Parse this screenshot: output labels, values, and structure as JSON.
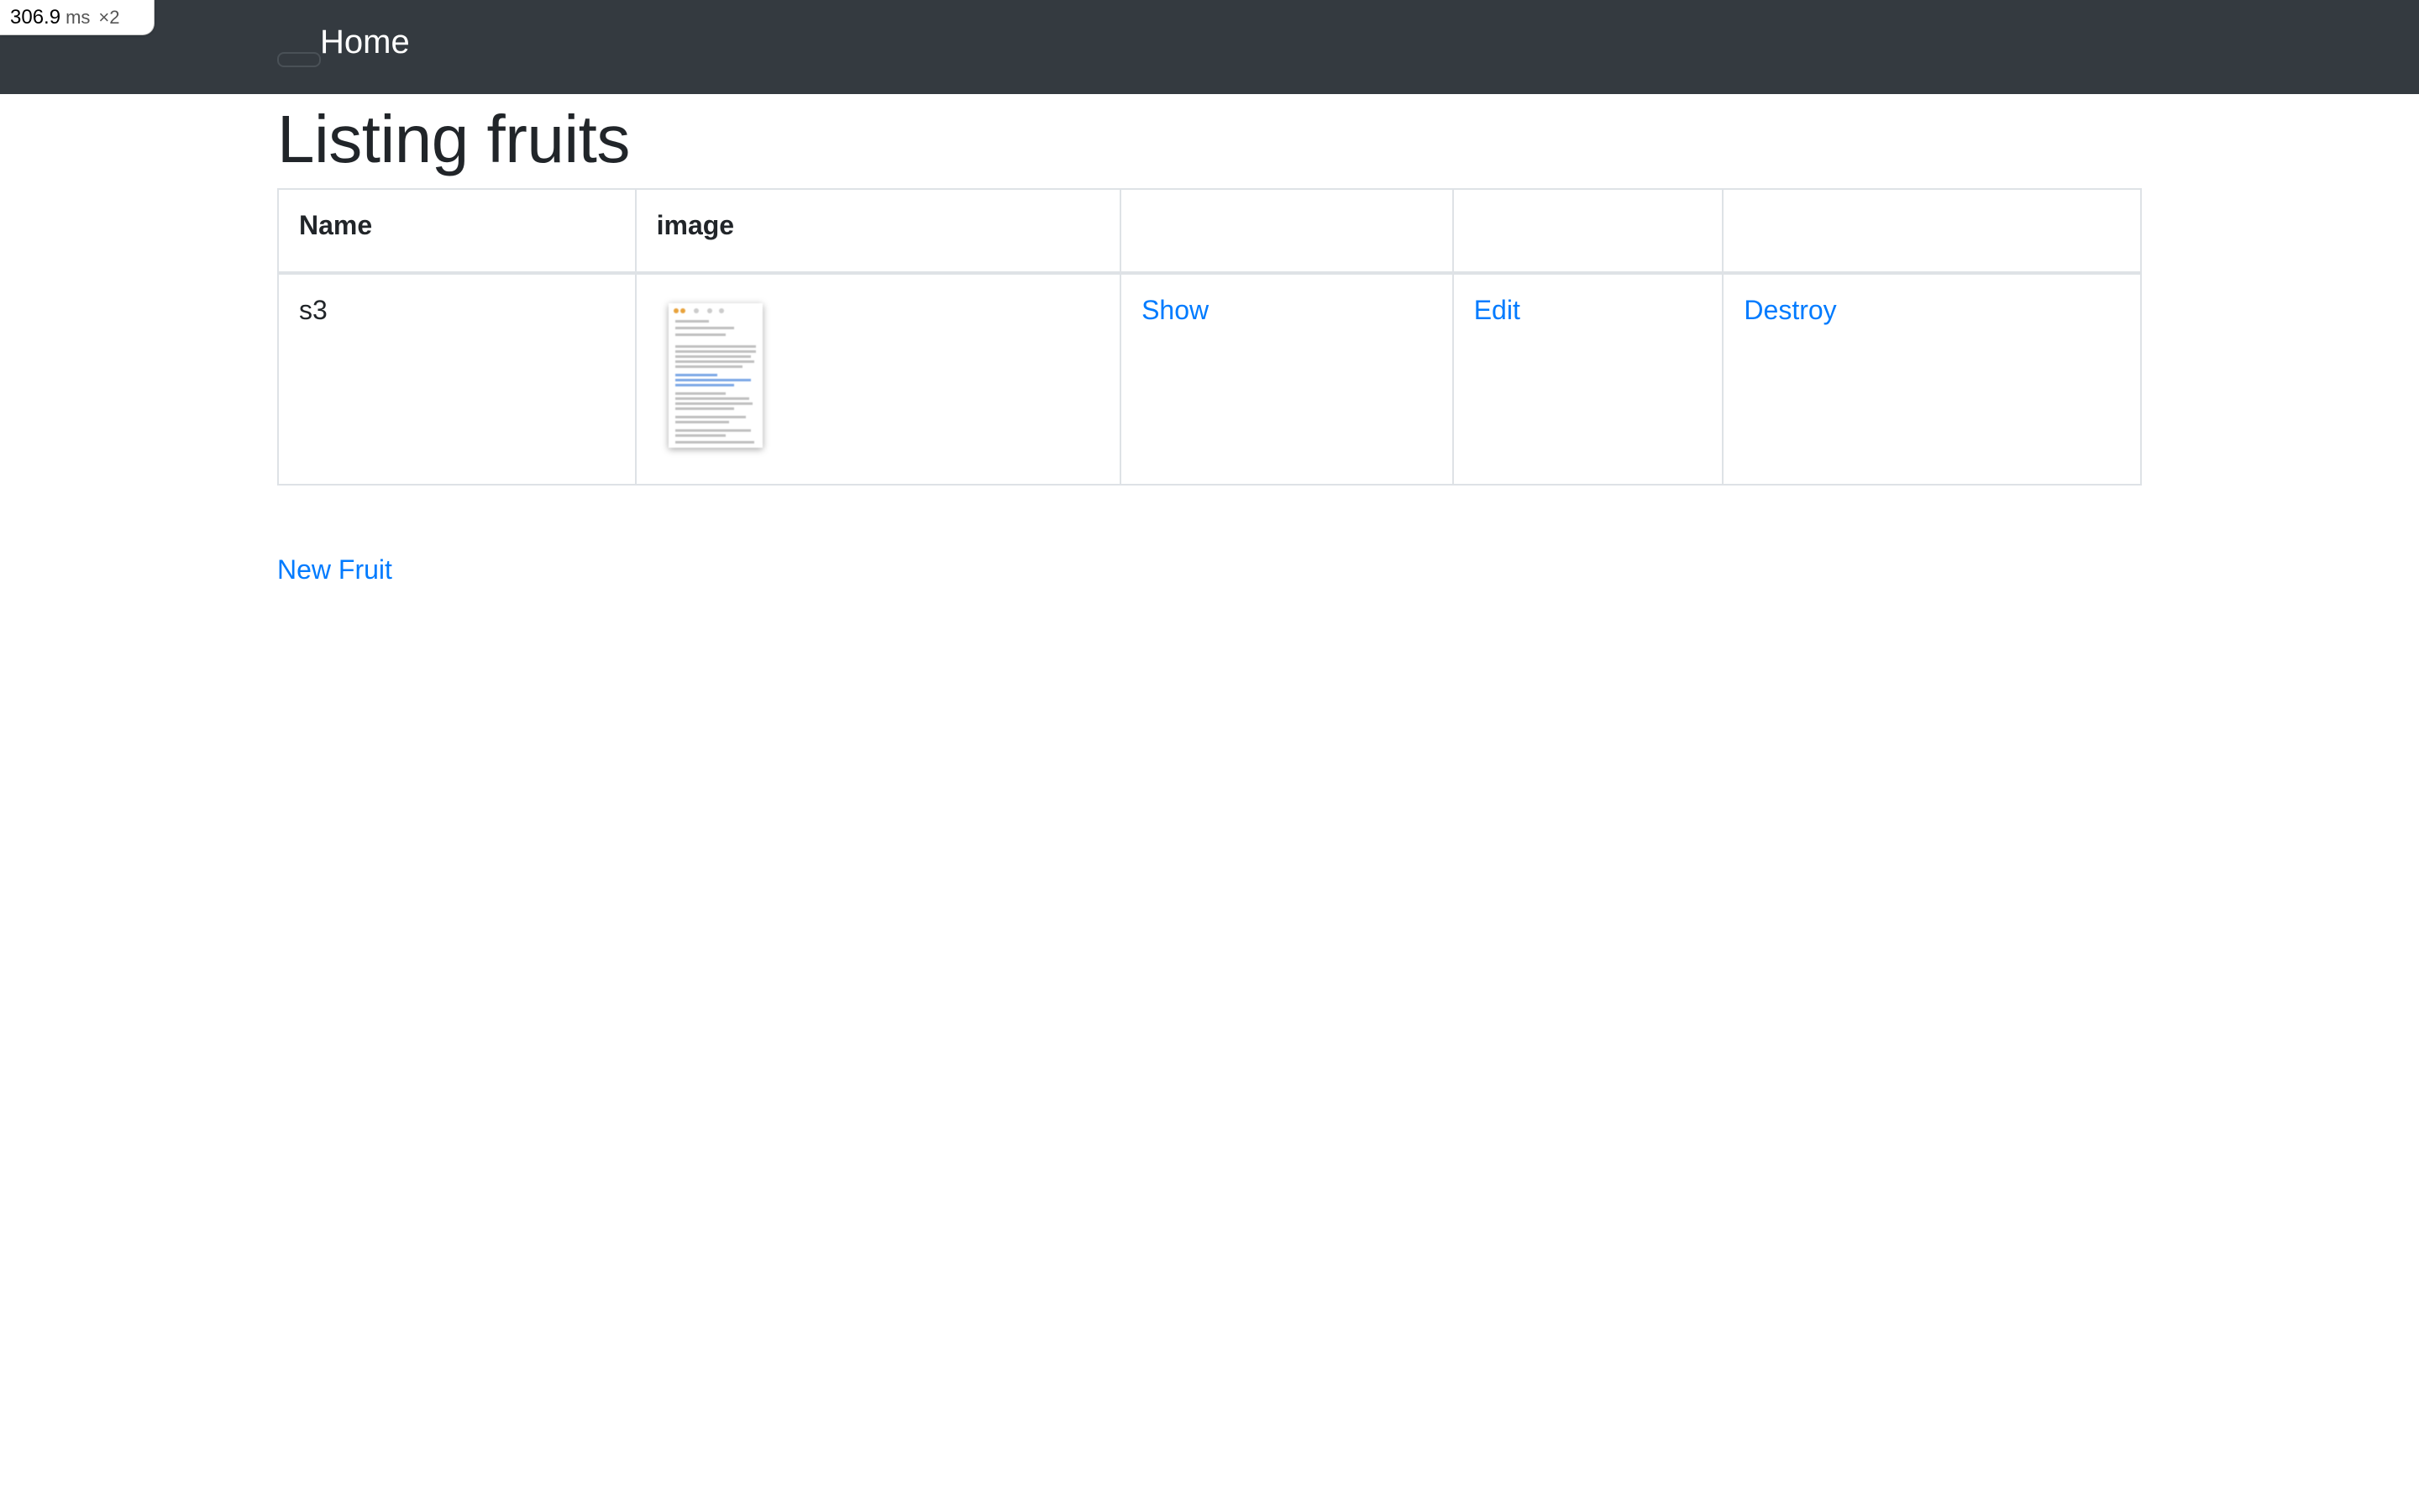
{
  "perf": {
    "value": "306.9",
    "unit": "ms",
    "multiplier": "×2"
  },
  "navbar": {
    "brand": "Home"
  },
  "page": {
    "title": "Listing fruits"
  },
  "table": {
    "headers": [
      "Name",
      "image",
      "",
      "",
      ""
    ],
    "rows": [
      {
        "name": "s3",
        "show": "Show",
        "edit": "Edit",
        "destroy": "Destroy"
      }
    ]
  },
  "actions": {
    "new_fruit": "New Fruit"
  },
  "colors": {
    "navbar_bg": "#343a40",
    "link": "#007bff",
    "text": "#212529",
    "border": "#dee2e6"
  }
}
